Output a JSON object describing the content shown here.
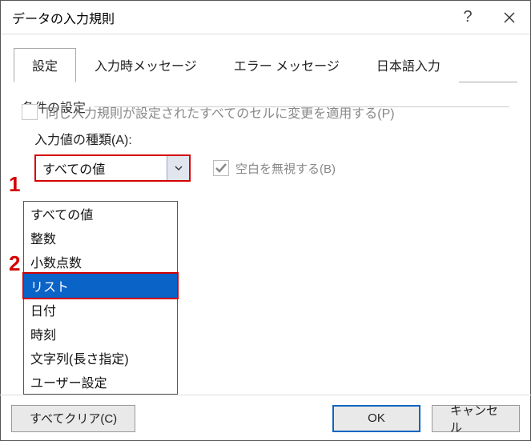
{
  "titlebar": {
    "title": "データの入力規則"
  },
  "tabs": {
    "items": [
      {
        "label": "設定"
      },
      {
        "label": "入力時メッセージ"
      },
      {
        "label": "エラー メッセージ"
      },
      {
        "label": "日本語入力"
      }
    ]
  },
  "section": {
    "header": "条件の設定"
  },
  "allow": {
    "label": "入力値の種類(A):",
    "value": "すべての値",
    "options": [
      "すべての値",
      "整数",
      "小数点数",
      "リスト",
      "日付",
      "時刻",
      "文字列(長さ指定)",
      "ユーザー設定"
    ],
    "selected_index": 3
  },
  "ignore_blank": {
    "label": "空白を無視する(B)",
    "checked": true
  },
  "apply_changes": {
    "label": "同じ入力規則が設定されたすべてのセルに変更を適用する(P)",
    "checked": false
  },
  "callouts": {
    "one": "1",
    "two": "2"
  },
  "buttons": {
    "clear": "すべてクリア(C)",
    "ok": "OK",
    "cancel": "キャンセル"
  }
}
